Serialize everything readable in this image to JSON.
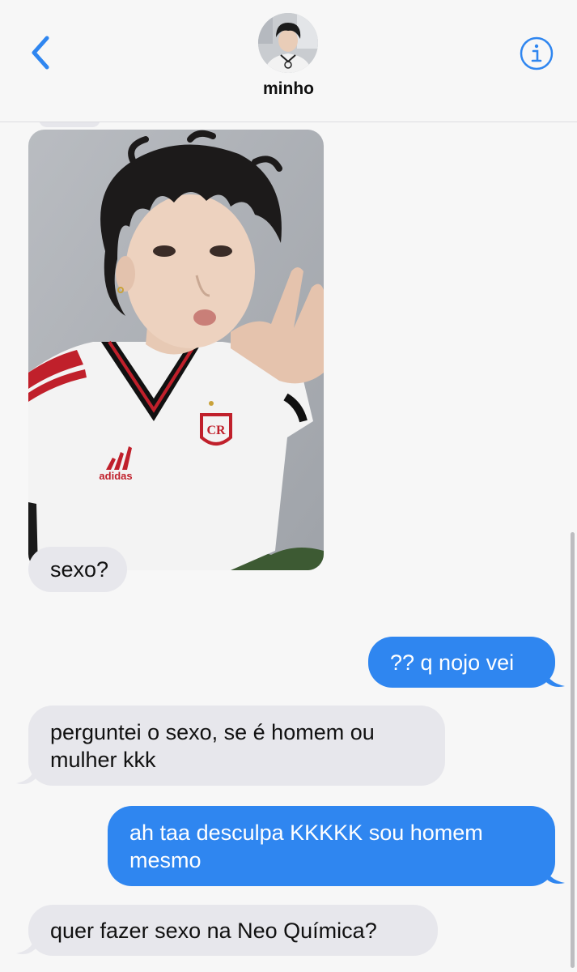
{
  "header": {
    "contact_name": "minho",
    "avatar_label": "minho avatar"
  },
  "colors": {
    "accent": "#2f86f0",
    "incoming_bubble": "#e7e7ec",
    "outgoing_bubble": "#2f86f0"
  },
  "messages": [
    {
      "direction": "incoming",
      "type": "image",
      "text": ""
    },
    {
      "direction": "incoming",
      "type": "text",
      "text": "sexo?"
    },
    {
      "direction": "outgoing",
      "type": "text",
      "text": "?? q nojo vei"
    },
    {
      "direction": "incoming",
      "type": "text",
      "text": "perguntei o sexo, se é homem ou mulher kkk"
    },
    {
      "direction": "outgoing",
      "type": "text",
      "text": "ah taa desculpa KKKKK sou homem mesmo"
    },
    {
      "direction": "incoming",
      "type": "text",
      "text": "quer fazer sexo na Neo Química?"
    }
  ],
  "icons": {
    "back": "chevron-left-icon",
    "info": "info-icon"
  }
}
